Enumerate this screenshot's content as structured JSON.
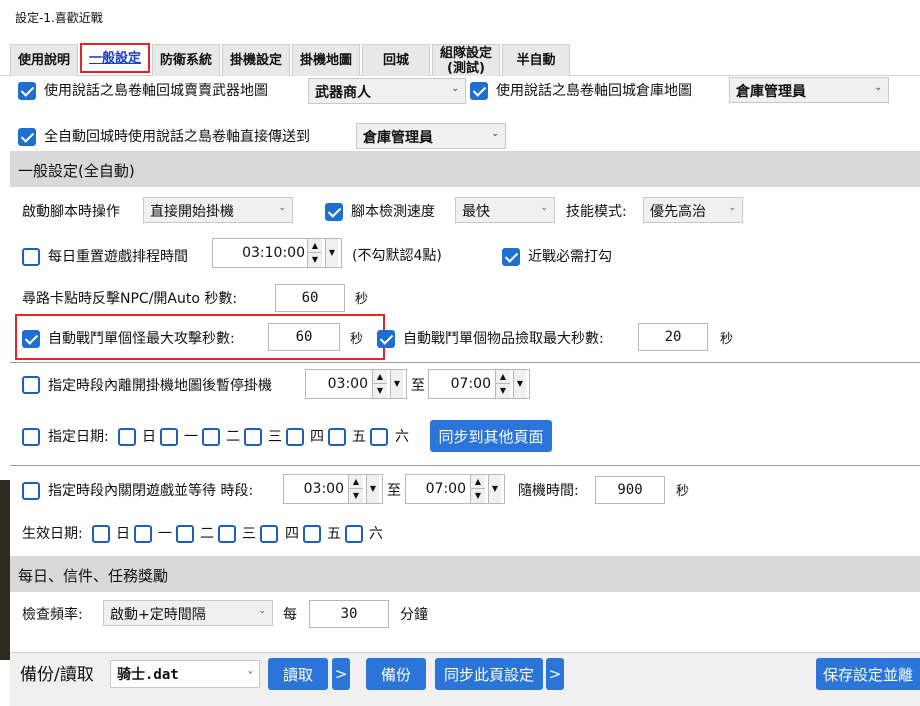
{
  "window": {
    "title": "設定-1.喜歡近戰"
  },
  "tabs": [
    "使用說明",
    "一般設定",
    "防衛系統",
    "掛機設定",
    "掛機地圖",
    "回城",
    "組隊設定\n(測試)",
    "半自動"
  ],
  "top": {
    "sell_label": "使用說話之島卷軸回城賣賣武器地圖",
    "sell_value": "武器商人",
    "store_label": "使用說話之島卷軸回城倉庫地圖",
    "store_value": "倉庫管理員",
    "teleport_label": "全自動回城時使用說話之島卷軸直接傳送到",
    "teleport_value": "倉庫管理員"
  },
  "section1": {
    "title": "一般設定(全自動)"
  },
  "row_start": {
    "label": "啟動腳本時操作",
    "value": "直接開始掛機",
    "speed_label": "腳本檢測速度",
    "speed_value": "最快",
    "skill_label": "技能模式:",
    "skill_value": "優先高治"
  },
  "row_reset": {
    "label": "每日重置遊戲排程時間",
    "time": "03:10:00",
    "note": "(不勾默認4點)",
    "melee_label": "近戰必需打勾"
  },
  "row_stuck": {
    "label": "尋路卡點時反擊NPC/開Auto 秒數:",
    "value": "60",
    "unit": "秒"
  },
  "row_fight": {
    "label": "自動戰鬥單個怪最大攻擊秒數:",
    "value": "60",
    "unit": "秒",
    "pick_label": "自動戰鬥單個物品撿取最大秒數:",
    "pick_value": "20",
    "pick_unit": "秒"
  },
  "row_pause": {
    "label": "指定時段內離開掛機地圖後暫停掛機",
    "from": "03:00",
    "to_label": "至",
    "to": "07:00"
  },
  "row_date": {
    "label": "指定日期:",
    "days": [
      "日",
      "一",
      "二",
      "三",
      "四",
      "五",
      "六"
    ],
    "sync_btn": "同步到其他頁面"
  },
  "row_close": {
    "label": "指定時段內關閉遊戲並等待 時段:",
    "from": "03:00",
    "to_label": "至",
    "to": "07:00",
    "rand_label": "隨機時間:",
    "rand_value": "900",
    "rand_unit": "秒"
  },
  "row_effective": {
    "label": "生效日期:",
    "days": [
      "日",
      "一",
      "二",
      "三",
      "四",
      "五",
      "六"
    ]
  },
  "section2": {
    "title": "每日、信件、任務獎勵"
  },
  "row_check": {
    "label": "檢查頻率:",
    "value": "啟動+定時間隔",
    "every": "每",
    "minutes": "30",
    "unit": "分鐘"
  },
  "bottom": {
    "label": "備份/讀取",
    "file": "骑士.dat",
    "read": "讀取",
    "more": ">",
    "backup": "備份",
    "sync": "同步此頁設定",
    "more2": ">",
    "save": "保存設定並離"
  }
}
